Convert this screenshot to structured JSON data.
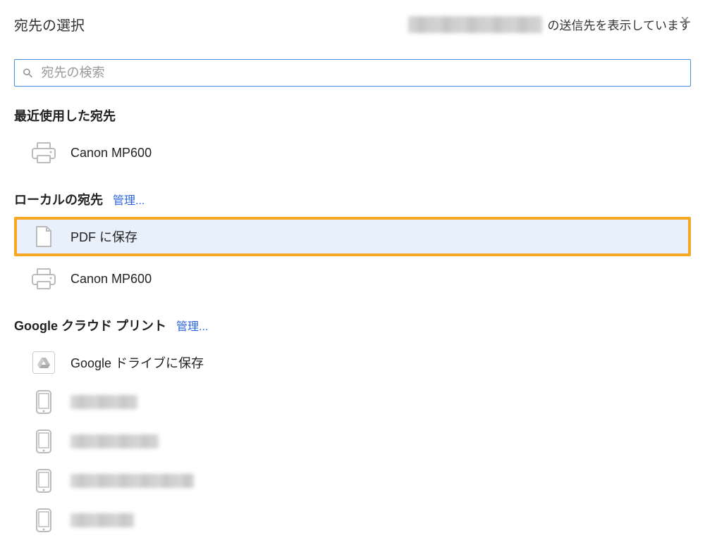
{
  "header": {
    "title": "宛先の選択",
    "subtitle_suffix": "の送信先を表示しています",
    "close_label": "×"
  },
  "search": {
    "placeholder": "宛先の検索"
  },
  "sections": {
    "recent": {
      "title": "最近使用した宛先",
      "items": [
        {
          "label": "Canon MP600",
          "icon": "printer"
        }
      ]
    },
    "local": {
      "title": "ローカルの宛先",
      "manage": "管理...",
      "items": [
        {
          "label": "PDF に保存",
          "icon": "document",
          "highlighted": true
        },
        {
          "label": "Canon MP600",
          "icon": "printer"
        }
      ]
    },
    "cloud": {
      "title": "Google クラウド プリント",
      "manage": "管理...",
      "items": [
        {
          "label": "Google ドライブに保存",
          "icon": "drive"
        }
      ]
    }
  }
}
